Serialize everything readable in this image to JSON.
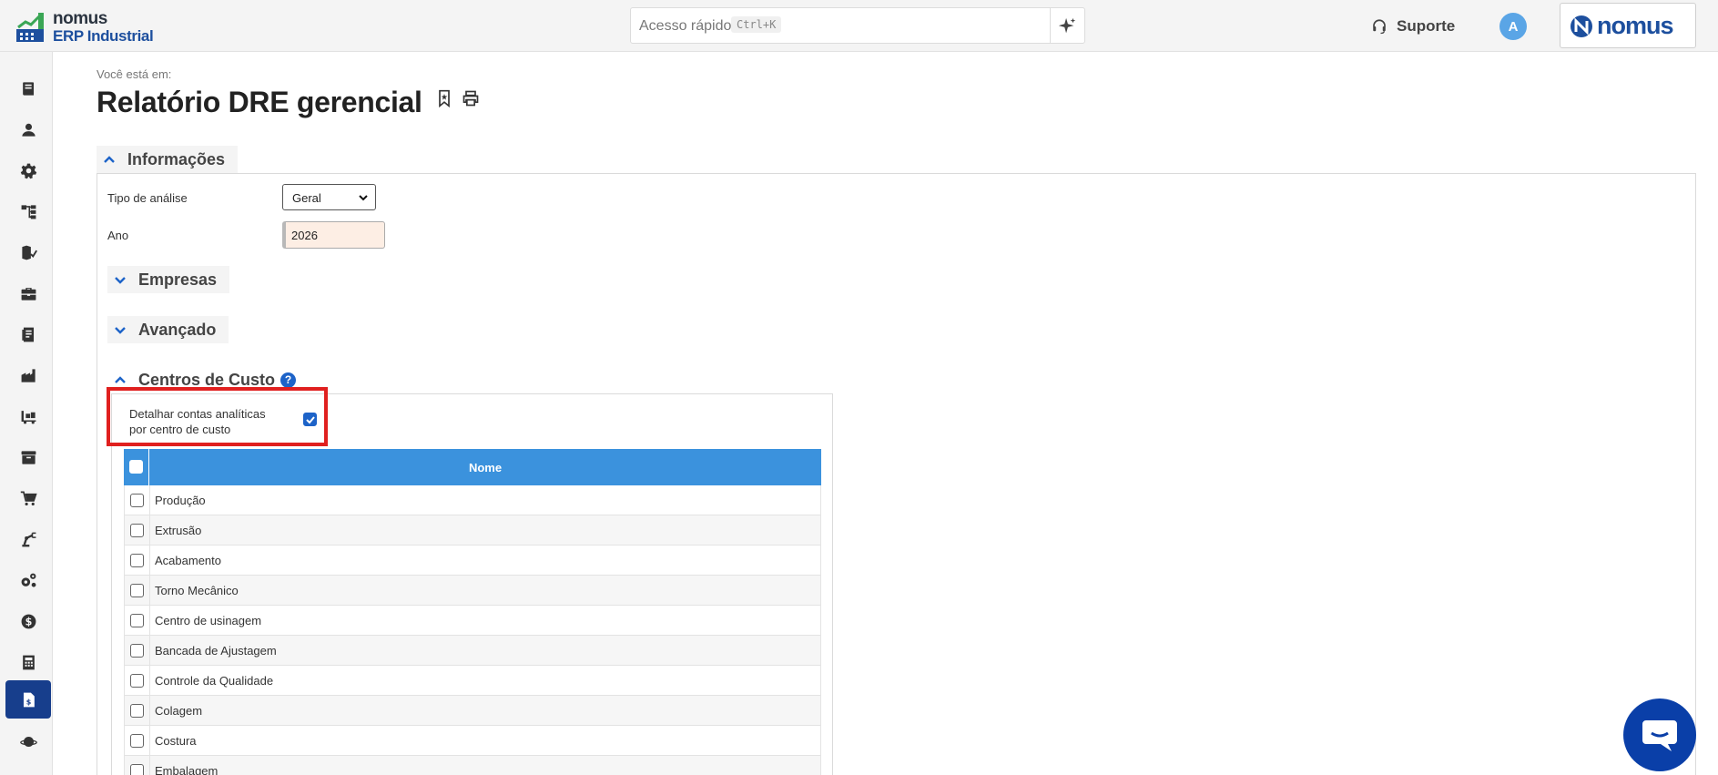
{
  "header": {
    "brand_name": "nomus",
    "brand_sub": "ERP Industrial",
    "quick_search_label": "Acesso rápido",
    "quick_search_shortcut": "Ctrl+K",
    "support_label": "Suporte",
    "avatar_initial": "A",
    "logo_text": "nomus"
  },
  "sidebar": {
    "items": [
      {
        "icon": "book-icon"
      },
      {
        "icon": "user-icon"
      },
      {
        "icon": "gear-icon"
      },
      {
        "icon": "hierarchy-icon"
      },
      {
        "icon": "map-check-icon"
      },
      {
        "icon": "briefcase-icon"
      },
      {
        "icon": "document-icon"
      },
      {
        "icon": "factory-icon"
      },
      {
        "icon": "forklift-icon"
      },
      {
        "icon": "archive-icon"
      },
      {
        "icon": "cart-icon"
      },
      {
        "icon": "robot-arm-icon"
      },
      {
        "icon": "gears-icon"
      },
      {
        "icon": "dollar-icon"
      },
      {
        "icon": "calculator-icon"
      },
      {
        "icon": "invoice-icon",
        "active": true
      },
      {
        "icon": "planet-icon"
      }
    ]
  },
  "page": {
    "breadcrumb": "Você está em:",
    "title": "Relatório DRE gerencial"
  },
  "sections": {
    "informacoes": "Informações",
    "empresas": "Empresas",
    "avancado": "Avançado",
    "centros_de_custo": "Centros de Custo"
  },
  "form": {
    "tipo_label": "Tipo de análise",
    "tipo_value": "Geral",
    "ano_label": "Ano",
    "ano_value": "2026"
  },
  "centros": {
    "help_glyph": "?",
    "detail_label": "Detalhar contas analíticas por centro de custo",
    "detail_checked": true,
    "column_header": "Nome",
    "rows": [
      "Produção",
      "Extrusão",
      "Acabamento",
      "Torno Mecânico",
      "Centro de usinagem",
      "Bancada de Ajustagem",
      "Controle da Qualidade",
      "Colagem",
      "Costura",
      "Embalagem"
    ]
  },
  "colors": {
    "brand_blue": "#1d4f9e",
    "table_header": "#3b92dd",
    "highlight": "#e0201f",
    "active_nav": "#173e8c"
  }
}
